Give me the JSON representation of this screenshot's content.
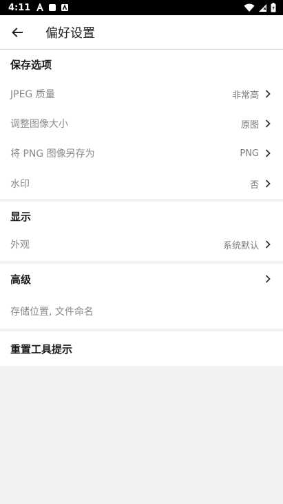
{
  "status_bar": {
    "time": "4:11"
  },
  "app_bar": {
    "title": "偏好设置"
  },
  "sections": {
    "save_options": {
      "header": "保存选项",
      "items": [
        {
          "label": "JPEG 质量",
          "value": "非常高"
        },
        {
          "label": "调整图像大小",
          "value": "原图"
        },
        {
          "label": "将 PNG 图像另存为",
          "value": "PNG"
        },
        {
          "label": "水印",
          "value": "否"
        }
      ]
    },
    "display": {
      "header": "显示",
      "items": [
        {
          "label": "外观",
          "value": "系统默认"
        }
      ]
    },
    "advanced": {
      "header": "高级",
      "subtitle": "存储位置, 文件命名"
    },
    "reset": {
      "label": "重置工具提示"
    }
  }
}
